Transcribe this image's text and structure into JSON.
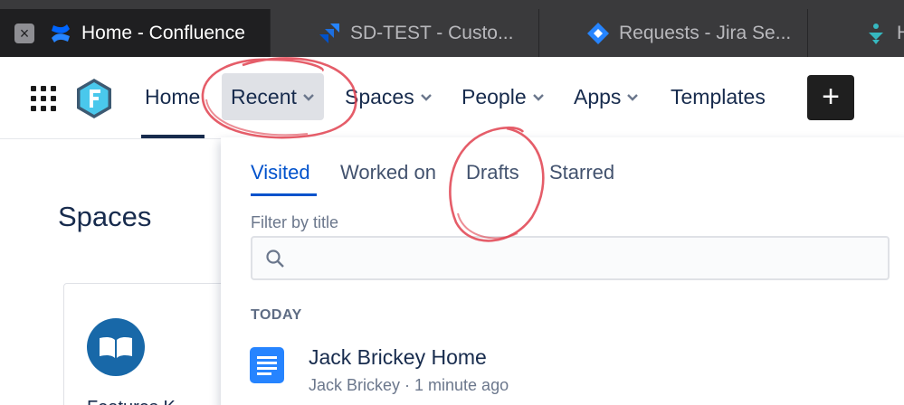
{
  "browser": {
    "tabs": [
      {
        "label": "Home - Confluence",
        "active": true
      },
      {
        "label": "SD-TEST - Custo...",
        "active": false
      },
      {
        "label": "Requests - Jira Se...",
        "active": false
      },
      {
        "label": "H",
        "active": false
      }
    ]
  },
  "header": {
    "nav": [
      {
        "label": "Home"
      },
      {
        "label": "Recent"
      },
      {
        "label": "Spaces"
      },
      {
        "label": "People"
      },
      {
        "label": "Apps"
      },
      {
        "label": "Templates"
      }
    ],
    "create_label": "+"
  },
  "page": {
    "spaces_title": "Spaces",
    "space_card_name": "Features K..."
  },
  "recent_menu": {
    "tabs": [
      {
        "label": "Visited"
      },
      {
        "label": "Worked on"
      },
      {
        "label": "Drafts"
      },
      {
        "label": "Starred"
      }
    ],
    "filter_label": "Filter by title",
    "filter_value": "",
    "section_label": "TODAY",
    "items": [
      {
        "title": "Jack Brickey Home",
        "meta": "Jack Brickey · 1 minute ago"
      }
    ]
  },
  "colors": {
    "accent": "#0052cc",
    "text": "#172b4d",
    "annotation": "#e0414f"
  }
}
